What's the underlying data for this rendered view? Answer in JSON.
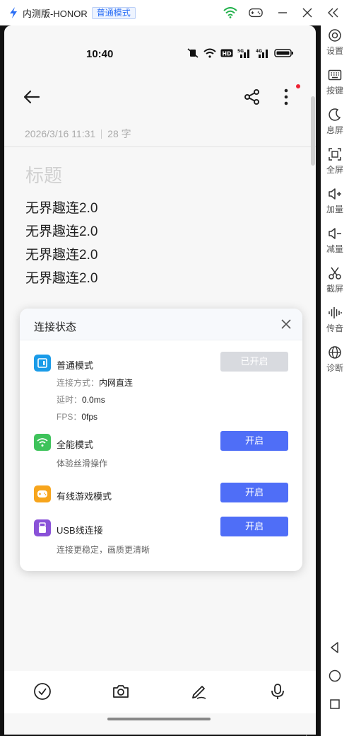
{
  "window": {
    "app_title": "内测版-HONOR",
    "mode_badge": "普通模式"
  },
  "phone": {
    "status_time": "10:40",
    "note": {
      "meta_date": "2026/3/16 11:31",
      "meta_count": "28 字",
      "title_placeholder": "标题",
      "lines": [
        "无界趣连2.0",
        "无界趣连2.0",
        "无界趣连2.0",
        "无界趣连2.0"
      ]
    }
  },
  "dialog": {
    "title": "连接状态",
    "modes": [
      {
        "name": "普通模式",
        "button": "已开启",
        "color": "#1a9be8",
        "details": [
          {
            "label": "连接方式：",
            "value": "内网直连"
          },
          {
            "label": "延时：",
            "value": "0.0ms"
          },
          {
            "label": "FPS：",
            "value": "0fps"
          }
        ]
      },
      {
        "name": "全能模式",
        "button": "开启",
        "color": "#3ec35b",
        "subtitle": "体验丝滑操作"
      },
      {
        "name": "有线游戏模式",
        "button": "开启",
        "color": "#f7a51c"
      },
      {
        "name": "USB线连接",
        "button": "开启",
        "color": "#8a52d8",
        "subtitle": "连接更稳定，画质更清晰"
      }
    ]
  },
  "sidebar": {
    "items": [
      "设置",
      "按键",
      "息屏",
      "全屏",
      "加量",
      "减量",
      "截屏",
      "传音",
      "诊断"
    ]
  },
  "colors": {
    "accent": "#4f6ef7",
    "badge_blue": "#2a6ef5",
    "wifi_green": "#22b14c"
  }
}
